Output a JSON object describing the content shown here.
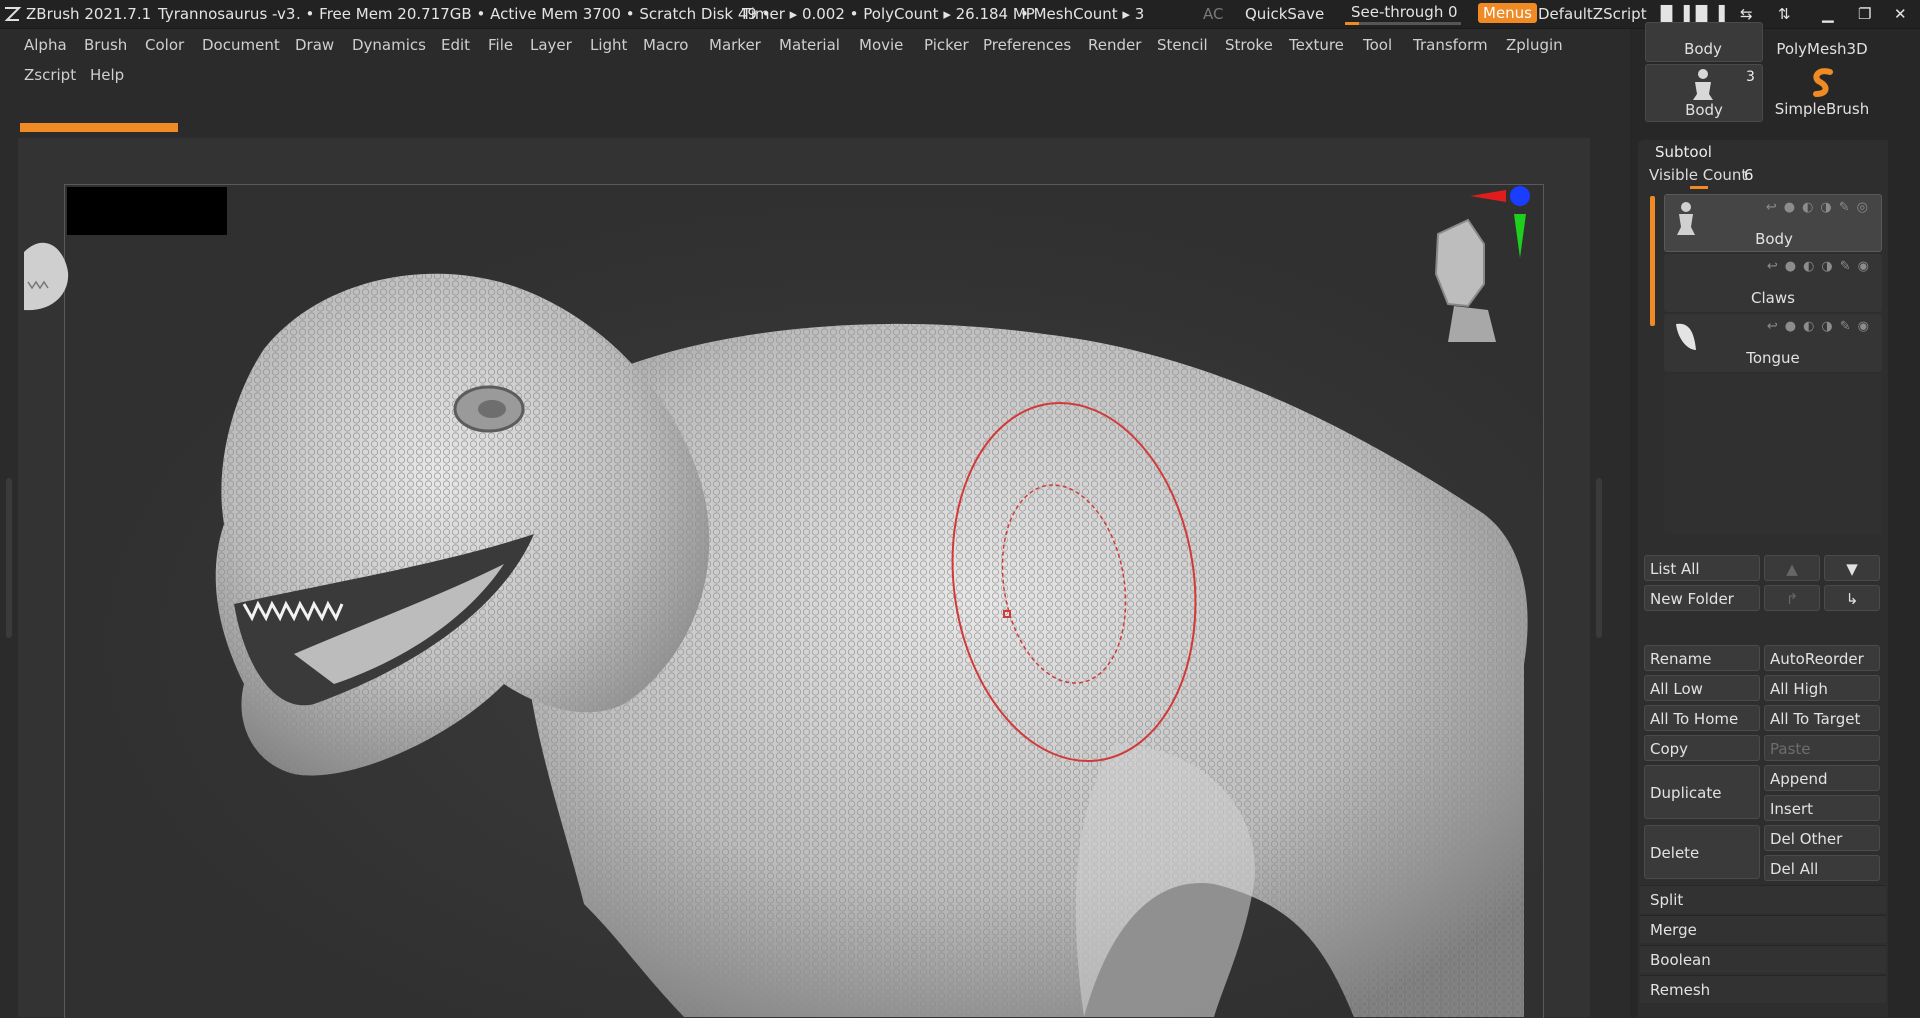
{
  "topbar": {
    "app": "ZBrush 2021.7.1",
    "document": "Tyrannosaurus -v3",
    "free_mem": ". • Free Mem 20.717GB • Active Mem 3700 • Scratch Disk 49 •",
    "timer": "Timer ▸ 0.002 • PolyCount ▸ 26.184 MP",
    "meshcount": "• MeshCount ▸ 3",
    "ac": "AC",
    "quicksave": "QuickSave",
    "seethrough_label": "See-through",
    "seethrough_value": "0",
    "seethrough_level": 0,
    "menus": "Menus",
    "script": "DefaultZScript"
  },
  "menubar": {
    "row1": [
      "Alpha",
      "Brush",
      "Color",
      "Document",
      "Draw",
      "Dynamics",
      "Edit",
      "File",
      "Layer",
      "Light",
      "Macro",
      "Marker",
      "Material",
      "Movie",
      "Picker",
      "Preferences",
      "Render",
      "Stencil",
      "Stroke",
      "Texture",
      "Tool",
      "Transform",
      "Zplugin"
    ],
    "row2": [
      "Zscript",
      "Help"
    ]
  },
  "tool_thumbs": {
    "top_left": "Body",
    "top_right": "PolyMesh3D",
    "bottom_left": "Body",
    "bottom_left_count": "3",
    "bottom_right": "SimpleBrush"
  },
  "subtool": {
    "title": "Subtool",
    "visible_count_label": "Visible Count",
    "visible_count_value": "6",
    "items": [
      {
        "label": "Body"
      },
      {
        "label": "Claws"
      },
      {
        "label": "Tongue"
      }
    ],
    "buttons": {
      "list_all": "List All",
      "new_folder": "New Folder",
      "rename": "Rename",
      "autoreorder": "AutoReorder",
      "all_low": "All Low",
      "all_high": "All High",
      "all_to_home": "All To Home",
      "all_to_target": "All To Target",
      "copy": "Copy",
      "paste": "Paste",
      "duplicate": "Duplicate",
      "append": "Append",
      "insert": "Insert",
      "delete": "Delete",
      "del_other": "Del Other",
      "del_all": "Del All"
    },
    "sections": [
      "Split",
      "Merge",
      "Boolean",
      "Remesh"
    ]
  },
  "colors": {
    "accent": "#f08a24",
    "panel": "#272727",
    "canvas": "#333333",
    "brush_ring": "#d23a3a"
  }
}
